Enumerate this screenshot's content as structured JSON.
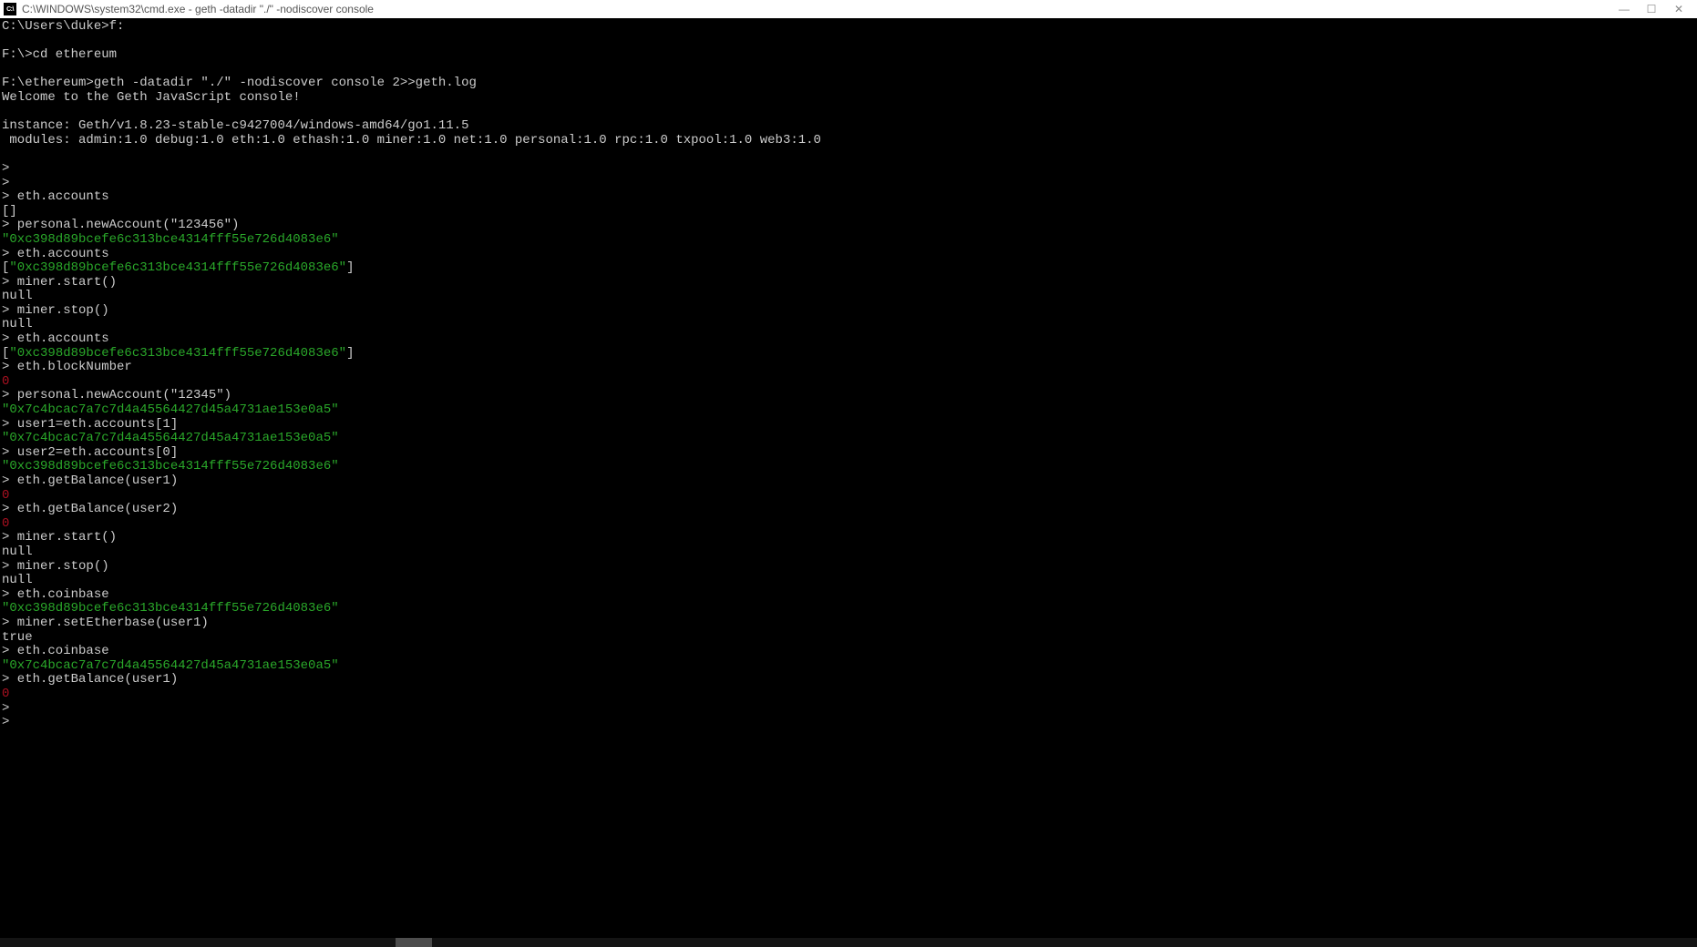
{
  "titlebar": {
    "icon_text": "C:\\",
    "title": "C:\\WINDOWS\\system32\\cmd.exe - geth  -datadir \"./\" -nodiscover console",
    "min": "—",
    "max": "☐",
    "close": "✕"
  },
  "lines": [
    {
      "segs": [
        {
          "t": "C:\\Users\\duke>f:"
        }
      ]
    },
    {
      "segs": [
        {
          "t": ""
        }
      ]
    },
    {
      "segs": [
        {
          "t": "F:\\>cd ethereum"
        }
      ]
    },
    {
      "segs": [
        {
          "t": ""
        }
      ]
    },
    {
      "segs": [
        {
          "t": "F:\\ethereum>geth -datadir \"./\" -nodiscover console 2>>geth.log"
        }
      ]
    },
    {
      "segs": [
        {
          "t": "Welcome to the Geth JavaScript console!"
        }
      ]
    },
    {
      "segs": [
        {
          "t": ""
        }
      ]
    },
    {
      "segs": [
        {
          "t": "instance: Geth/v1.8.23-stable-c9427004/windows-amd64/go1.11.5"
        }
      ]
    },
    {
      "segs": [
        {
          "t": " modules: admin:1.0 debug:1.0 eth:1.0 ethash:1.0 miner:1.0 net:1.0 personal:1.0 rpc:1.0 txpool:1.0 web3:1.0"
        }
      ]
    },
    {
      "segs": [
        {
          "t": ""
        }
      ]
    },
    {
      "segs": [
        {
          "t": ">"
        }
      ]
    },
    {
      "segs": [
        {
          "t": "> "
        }
      ]
    },
    {
      "segs": [
        {
          "t": "> eth.accounts"
        }
      ]
    },
    {
      "segs": [
        {
          "t": "[]"
        }
      ]
    },
    {
      "segs": [
        {
          "t": "> personal.newAccount(\"123456\")"
        }
      ]
    },
    {
      "segs": [
        {
          "t": "\"0xc398d89bcefe6c313bce4314fff55e726d4083e6\"",
          "c": "green"
        }
      ]
    },
    {
      "segs": [
        {
          "t": "> eth.accounts"
        }
      ]
    },
    {
      "segs": [
        {
          "t": "["
        },
        {
          "t": "\"0xc398d89bcefe6c313bce4314fff55e726d4083e6\"",
          "c": "green"
        },
        {
          "t": "]"
        }
      ]
    },
    {
      "segs": [
        {
          "t": "> miner.start()"
        }
      ]
    },
    {
      "segs": [
        {
          "t": "null"
        }
      ]
    },
    {
      "segs": [
        {
          "t": "> miner.stop()"
        }
      ]
    },
    {
      "segs": [
        {
          "t": "null"
        }
      ]
    },
    {
      "segs": [
        {
          "t": "> eth.accounts"
        }
      ]
    },
    {
      "segs": [
        {
          "t": "["
        },
        {
          "t": "\"0xc398d89bcefe6c313bce4314fff55e726d4083e6\"",
          "c": "green"
        },
        {
          "t": "]"
        }
      ]
    },
    {
      "segs": [
        {
          "t": "> eth.blockNumber"
        }
      ]
    },
    {
      "segs": [
        {
          "t": "0",
          "c": "red"
        }
      ]
    },
    {
      "segs": [
        {
          "t": "> personal.newAccount(\"12345\")"
        }
      ]
    },
    {
      "segs": [
        {
          "t": "\"0x7c4bcac7a7c7d4a45564427d45a4731ae153e0a5\"",
          "c": "green"
        }
      ]
    },
    {
      "segs": [
        {
          "t": "> user1=eth.accounts[1]"
        }
      ]
    },
    {
      "segs": [
        {
          "t": "\"0x7c4bcac7a7c7d4a45564427d45a4731ae153e0a5\"",
          "c": "green"
        }
      ]
    },
    {
      "segs": [
        {
          "t": "> user2=eth.accounts[0]"
        }
      ]
    },
    {
      "segs": [
        {
          "t": "\"0xc398d89bcefe6c313bce4314fff55e726d4083e6\"",
          "c": "green"
        }
      ]
    },
    {
      "segs": [
        {
          "t": "> eth.getBalance(user1)"
        }
      ]
    },
    {
      "segs": [
        {
          "t": "0",
          "c": "red"
        }
      ]
    },
    {
      "segs": [
        {
          "t": "> eth.getBalance(user2)"
        }
      ]
    },
    {
      "segs": [
        {
          "t": "0",
          "c": "red"
        }
      ]
    },
    {
      "segs": [
        {
          "t": "> miner.start()"
        }
      ]
    },
    {
      "segs": [
        {
          "t": "null"
        }
      ]
    },
    {
      "segs": [
        {
          "t": "> miner.stop()"
        }
      ]
    },
    {
      "segs": [
        {
          "t": "null"
        }
      ]
    },
    {
      "segs": [
        {
          "t": "> eth.coinbase"
        }
      ]
    },
    {
      "segs": [
        {
          "t": "\"0xc398d89bcefe6c313bce4314fff55e726d4083e6\"",
          "c": "green"
        }
      ]
    },
    {
      "segs": [
        {
          "t": "> miner.setEtherbase(user1)"
        }
      ]
    },
    {
      "segs": [
        {
          "t": "true"
        }
      ]
    },
    {
      "segs": [
        {
          "t": "> eth.coinbase"
        }
      ]
    },
    {
      "segs": [
        {
          "t": "\"0x7c4bcac7a7c7d4a45564427d45a4731ae153e0a5\"",
          "c": "green"
        }
      ]
    },
    {
      "segs": [
        {
          "t": "> eth.getBalance(user1)"
        }
      ]
    },
    {
      "segs": [
        {
          "t": "0",
          "c": "red"
        }
      ]
    },
    {
      "segs": [
        {
          "t": "> "
        }
      ]
    },
    {
      "segs": [
        {
          "t": "> "
        }
      ]
    }
  ]
}
